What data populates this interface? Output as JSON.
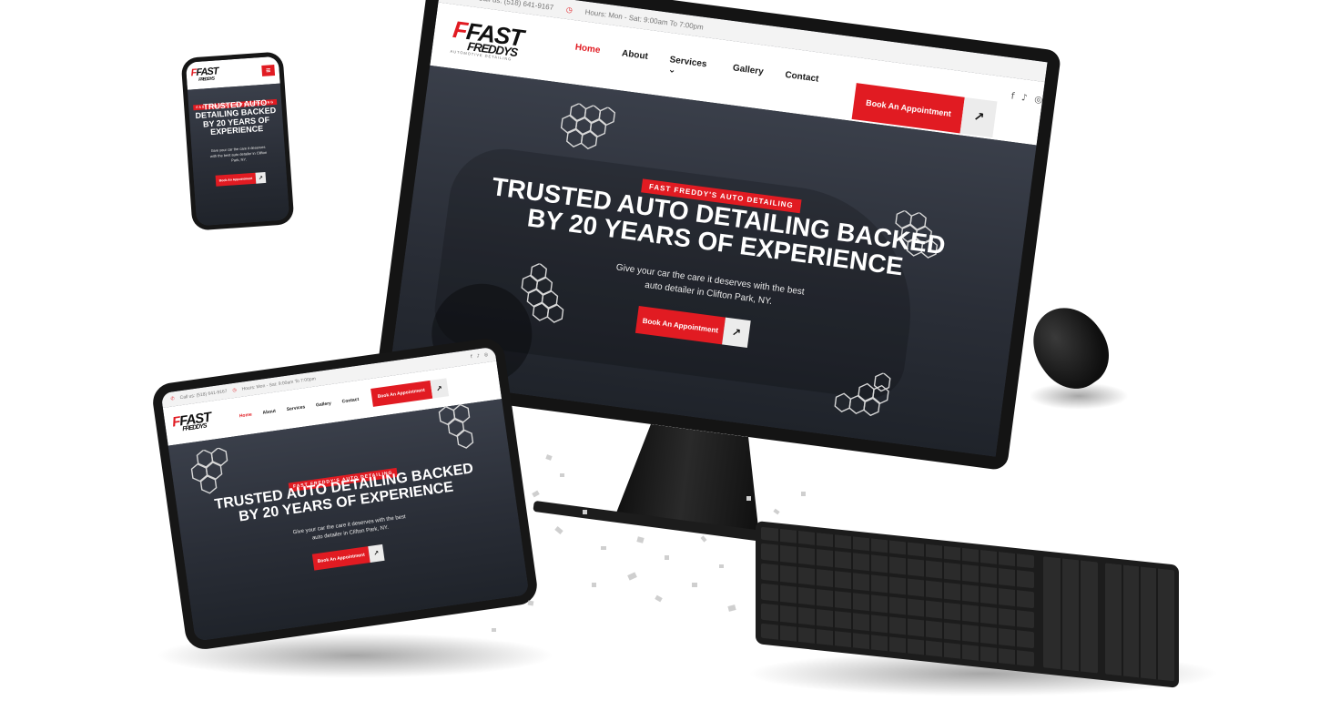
{
  "site": {
    "phone_label": "Call us: (518) 641-9167",
    "hours_label": "Hours: Mon - Sat: 9:00am To 7:00pm",
    "logo_main": "FAST",
    "logo_sub": "FREDDYS",
    "logo_tagline": "AUTOMOTIVE DETAILING",
    "nav": [
      {
        "label": "Home",
        "active": true
      },
      {
        "label": "About",
        "active": false
      },
      {
        "label": "Services",
        "active": false
      },
      {
        "label": "Gallery",
        "active": false
      },
      {
        "label": "Contact",
        "active": false
      }
    ],
    "cta_label": "Book An Appointment",
    "badge": "Fast Freddy's Auto Detailing",
    "headline_line1": "Trusted Auto Detailing Backed",
    "headline_line2": "By 20 Years Of Experience",
    "headline_mobile": [
      "Trusted Auto",
      "Detailing Backed",
      "By 20 Years Of",
      "Experience"
    ],
    "subtext_line1": "Give your car the care it deserves with the best",
    "subtext_line2": "auto detailer in Clifton Park, NY.",
    "subtext_mobile": [
      "Give your car the care it deserves",
      "with the best auto detailer in Clifton",
      "Park, NY."
    ],
    "tablet_subtext_line1": "Give your car the care it deserves with the best",
    "tablet_subtext_line2": "auto detailer in Clifton Park, NY.",
    "social_icons": [
      "facebook-icon",
      "tiktok-icon",
      "instagram-icon"
    ]
  },
  "colors": {
    "brand_red": "#e11b22",
    "hero_dark": "#2b2f38",
    "device_black": "#141414"
  }
}
